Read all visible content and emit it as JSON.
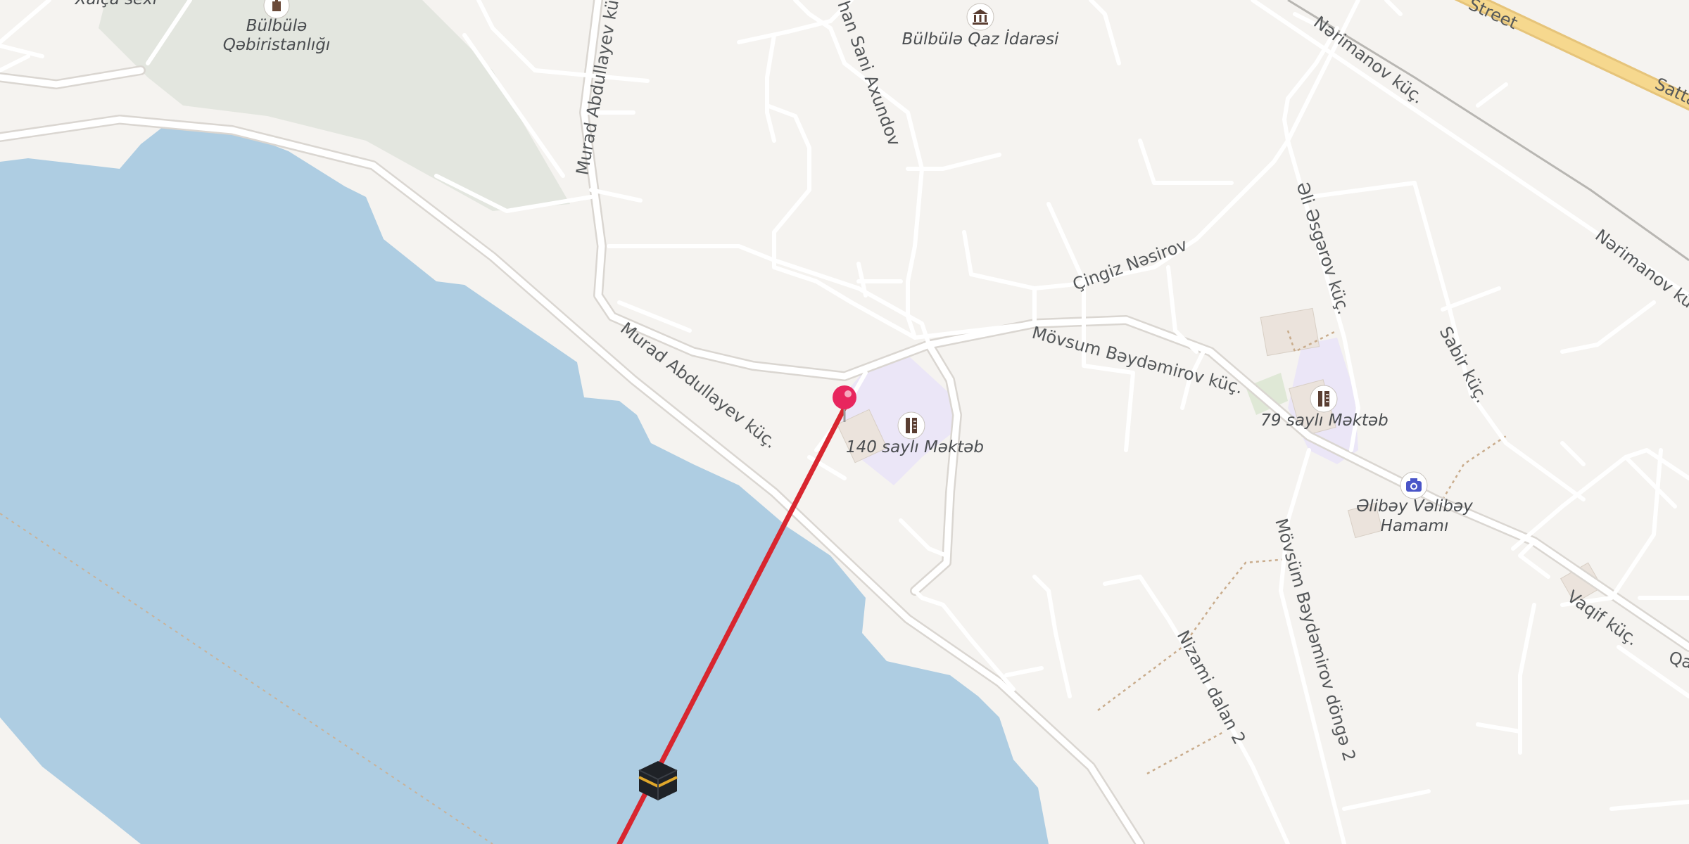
{
  "map": {
    "colors": {
      "water": "#aecde2",
      "land": "#f5f3f0",
      "cemetery": "#e3e6df",
      "school": "#ebe6f7",
      "route_line": "#d8262f",
      "pin": "#e8265e",
      "major_road": "#f6d88e"
    },
    "labels": {
      "cemetery_line1": "Bülbülə",
      "cemetery_line2": "Qəbiristanlığı",
      "top_left_cut": "Xalça sexi",
      "gas_office": "Bülbülə Qaz İdarəsi",
      "street_top": "Street",
      "sattar": "Satta",
      "murad_vertical": "Murad Abdullayev küç.",
      "murad_diag": "Murad Abdullayev küç.",
      "sani_axundov": "han Sani Axundov",
      "narimanov_1": "Nərimanov küç.",
      "narimanov_2": "Nərimanov küç.",
      "cingiz_nesirov": "Çingiz Nəsirov",
      "movsum_beydemirov": "Mövsum Bəydəmirov küç.",
      "ali_asgarov": "Əli Əsgərov küç.",
      "sabir": "Sabir küç.",
      "school_140": "140 saylı Məktəb",
      "school_79": "79 saylı Məktəb",
      "alibay_line1": "Əlibəy Vəlibəy",
      "alibay_line2": "Hamamı",
      "vaqif": "Vaqif küç.",
      "nizami_dalan": "Nizami dalan 2",
      "movsum_donge": "Mövsüm Bəydəmirov döngə 2",
      "right_cut": "Qa"
    },
    "icons": {
      "cemetery": "cemetery-icon",
      "gas_office": "government-building-icon",
      "school_140": "school-icon",
      "school_79": "school-icon",
      "bathhouse": "camera-icon",
      "pin": "location-pin-icon",
      "kaaba": "kaaba-icon"
    }
  }
}
